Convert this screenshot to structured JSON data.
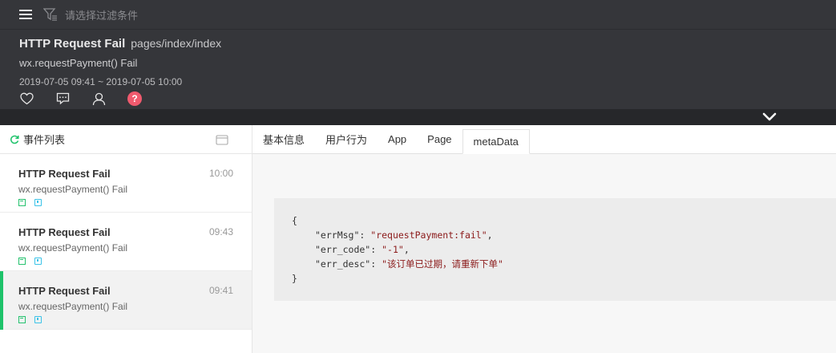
{
  "header": {
    "filter_placeholder": "请选择过滤条件",
    "title": "HTTP Request Fail",
    "page_path": "pages/index/index",
    "subtitle": "wx.requestPayment() Fail",
    "date_range": "2019-07-05 09:41 ~ 2019-07-05 10:00",
    "icons": [
      "heart-icon",
      "comment-icon",
      "user-icon",
      "help-icon"
    ],
    "help_label": "?",
    "accent_help": "#f05a6e"
  },
  "left_panel": {
    "title": "事件列表",
    "events": [
      {
        "title": "HTTP Request Fail",
        "subtitle": "wx.requestPayment() Fail",
        "time": "10:00"
      },
      {
        "title": "HTTP Request Fail",
        "subtitle": "wx.requestPayment() Fail",
        "time": "09:43"
      },
      {
        "title": "HTTP Request Fail",
        "subtitle": "wx.requestPayment() Fail",
        "time": "09:41"
      }
    ],
    "active_color": "#1ec26a"
  },
  "tabs": [
    "基本信息",
    "用户行为",
    "App",
    "Page",
    "metaData"
  ],
  "active_tab": "metaData",
  "metadata": {
    "open": "{",
    "close": "}",
    "lines": [
      {
        "key": "\"errMsg\"",
        "value": "\"requestPayment:fail\"",
        "sep": ","
      },
      {
        "key": "\"err_code\"",
        "value": "\"-1\"",
        "sep": ","
      },
      {
        "key": "\"err_desc\"",
        "value": "\"该订单已过期，请重新下单\"",
        "sep": ""
      }
    ]
  }
}
